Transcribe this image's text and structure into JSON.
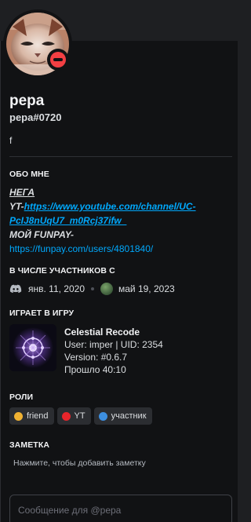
{
  "profile": {
    "display_name": "pepa",
    "username": "pepa#0720",
    "custom_status": "f",
    "status": "dnd",
    "status_color": "#f23f43"
  },
  "about": {
    "title": "ОБО МНЕ",
    "line1": "НЕГА",
    "yt_label": "YT-",
    "yt_link": "https://www.youtube.com/channel/UC-PcIJ8nUqU7_m0Rcj37ifw_",
    "funpay_label": "МОЙ FUNPAY-",
    "funpay_link": "https://funpay.com/users/4801840/"
  },
  "member_since": {
    "title": "В ЧИСЛЕ УЧАСТНИКОВ С",
    "discord_icon": "discord-icon",
    "discord_date": "янв. 11, 2020",
    "server_date": "май 19, 2023"
  },
  "activity": {
    "title": "ИГРАЕТ В ИГРУ",
    "game_name": "Celestial Recode",
    "details": "User: imper | UID: 2354",
    "state": "Version: #0.6.7",
    "elapsed": "Прошло 40:10"
  },
  "roles": {
    "title": "РОЛИ",
    "items": [
      {
        "name": "friend",
        "color": "#f0b232"
      },
      {
        "name": "YT",
        "color": "#e8252b"
      },
      {
        "name": "участник",
        "color": "#3d8fe0"
      }
    ]
  },
  "note": {
    "title": "ЗАМЕТКА",
    "placeholder": "Нажмите, чтобы добавить заметку"
  },
  "message": {
    "placeholder": "Сообщение для @pepa"
  },
  "colors": {
    "background": "#111214",
    "link": "#00a8fc",
    "dnd": "#f23f43"
  }
}
